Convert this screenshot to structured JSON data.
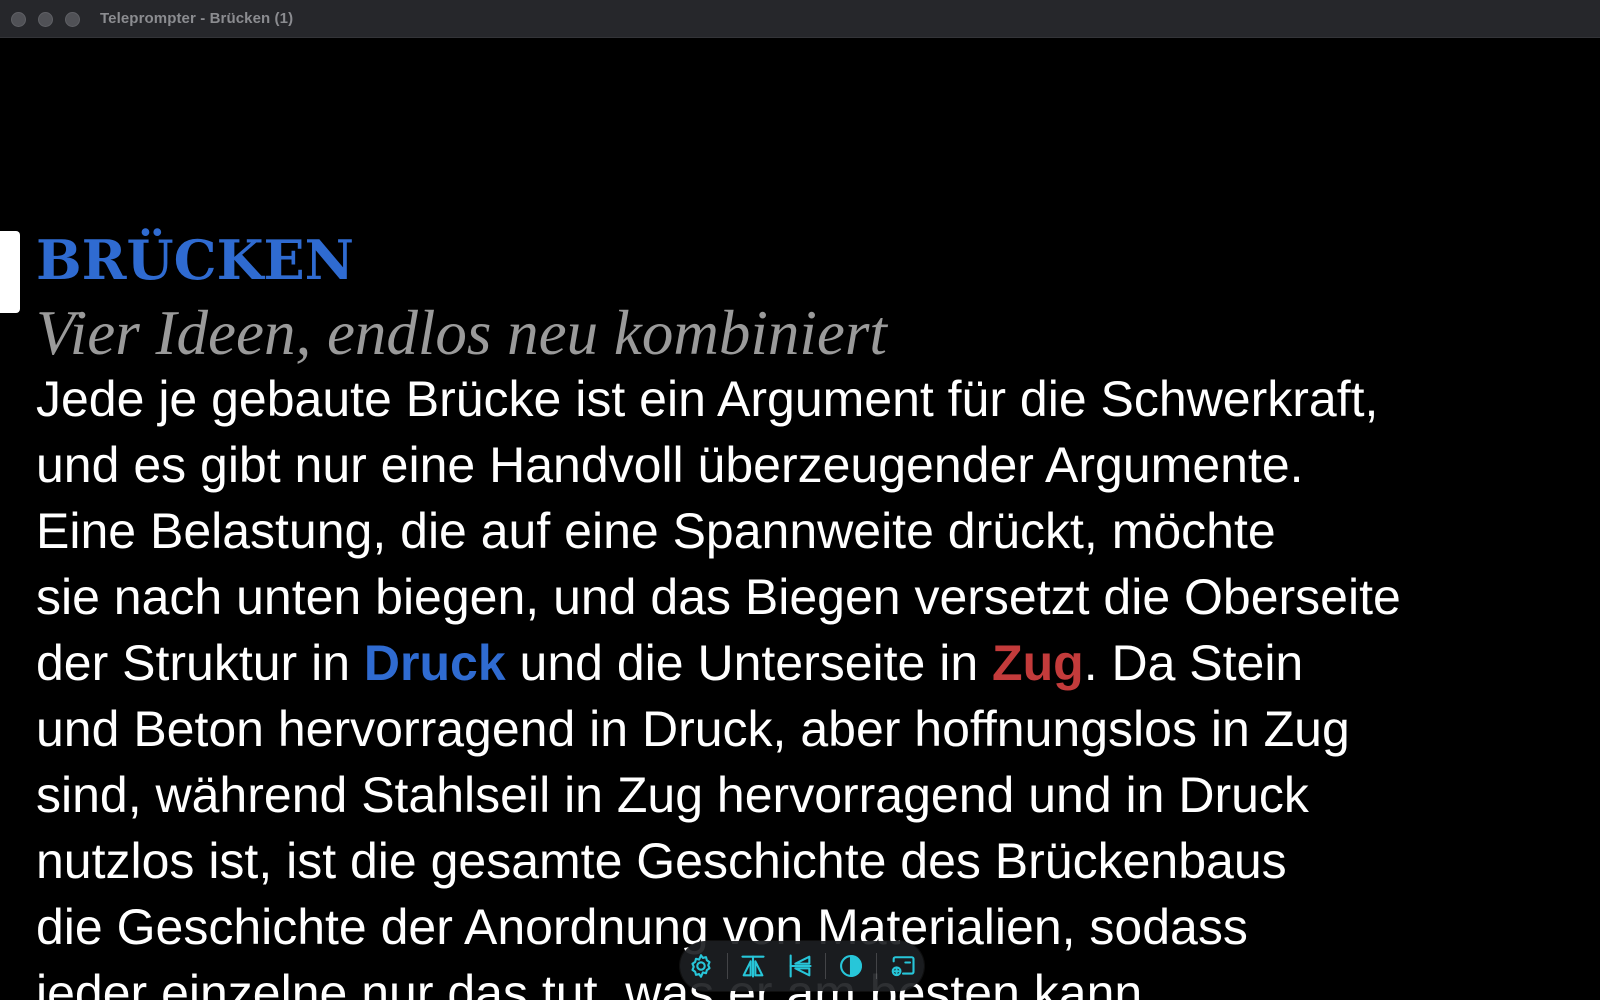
{
  "window": {
    "title": "Teleprompter - Brücken (1)"
  },
  "script": {
    "title": "BRÜCKEN",
    "subtitle": "Vier Ideen, endlos neu kombiniert",
    "lines": {
      "l1": "Jede je gebaute Brücke ist ein Argument für die Schwerkraft,",
      "l2": "und es gibt nur eine Handvoll überzeugender Argumente.",
      "l3": "Eine Belastung, die auf eine Spannweite drückt, möchte",
      "l4": "sie nach unten biegen, und das Biegen versetzt die Oberseite",
      "l5a": "der Struktur in ",
      "l5_druck": "Druck",
      "l5b": " und die Unterseite in ",
      "l5_zug": "Zug",
      "l5c": ". Da Stein",
      "l6": "und Beton hervorragend in Druck, aber hoffnungslos in Zug",
      "l7": "sind, während Stahlseil in Zug hervorragend und in Druck",
      "l8": "nutzlos ist, ist die gesamte Geschichte des Brückenbaus",
      "l9": "die Geschichte der Anordnung von Materialien, sodass",
      "l10": "jeder einzelne nur das tut, was er am besten kann."
    }
  },
  "toolbar": {
    "icons": [
      "gear-icon",
      "mirror-horizontal-icon",
      "mirror-vertical-icon",
      "contrast-icon",
      "cast-display-icon"
    ],
    "accent_color": "#27c6d9"
  },
  "colors": {
    "background": "#000000",
    "title_blue": "#2f6bd1",
    "emphasis_red": "#c33b3b",
    "subtitle_gray": "#9a9a9a"
  }
}
